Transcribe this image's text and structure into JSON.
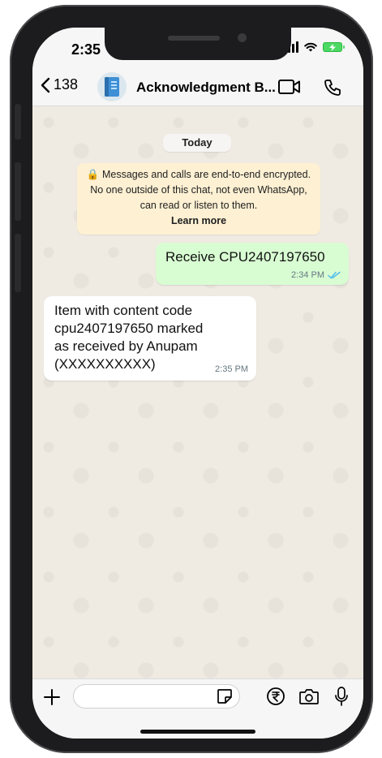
{
  "status": {
    "time": "2:35"
  },
  "header": {
    "back_count": "138",
    "title": "Acknowledgment B..."
  },
  "chat": {
    "date_label": "Today",
    "encryption_notice": "🔒 Messages and calls are end-to-end encrypted. No one outside of this chat, not even WhatsApp, can read or listen to them.",
    "learn_more": "Learn more",
    "messages": [
      {
        "direction": "outgoing",
        "text": "Receive CPU2407197650",
        "time": "2:34 PM",
        "status": "read"
      },
      {
        "direction": "incoming",
        "text": "Item with content code cpu2407197650 marked as received by Anupam (XXXXXXXXXX)",
        "time": "2:35 PM"
      }
    ]
  },
  "composer": {
    "placeholder": ""
  },
  "colors": {
    "outgoing_bubble": "#d9fdd3",
    "incoming_bubble": "#ffffff",
    "notice_bg": "#fdf0d3",
    "read_ticks": "#53bdeb",
    "chat_bg": "#efeae2"
  },
  "icons": {
    "back": "chevron-left-icon",
    "avatar": "notebook-icon",
    "video": "video-call-icon",
    "phone": "phone-icon",
    "attach": "plus-icon",
    "sticker": "sticker-icon",
    "payment": "rupee-icon",
    "camera": "camera-icon",
    "mic": "microphone-icon"
  }
}
